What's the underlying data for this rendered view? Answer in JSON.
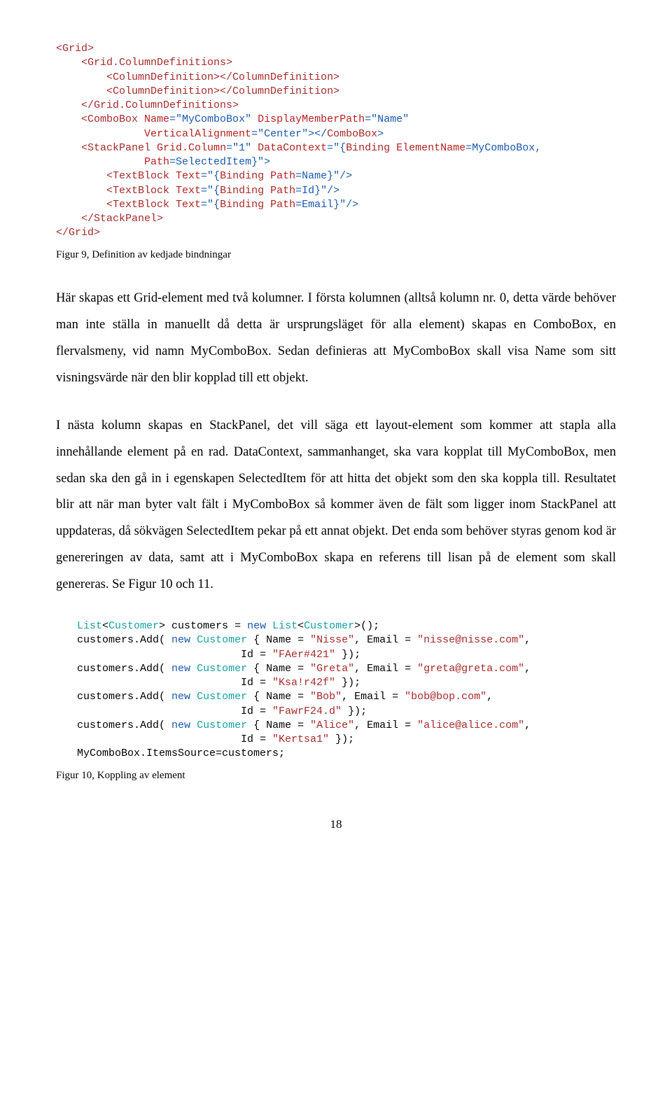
{
  "code1": {
    "l1": {
      "a": "<Grid>"
    },
    "l2": {
      "a": "    ",
      "b": "<Grid.ColumnDefinitions>"
    },
    "l3": {
      "a": "        ",
      "b": "<ColumnDefinition></ColumnDefinition>"
    },
    "l4": {
      "a": "        ",
      "b": "<ColumnDefinition></ColumnDefinition>"
    },
    "l5": {
      "a": "    ",
      "b": "</Grid.ColumnDefinitions>"
    },
    "l6": {
      "a": "    ",
      "b": "<ComboBox",
      "c": " Name",
      "d": "=\"MyComboBox\"",
      "e": " DisplayMemberPath",
      "f": "=\"Name\""
    },
    "l7": {
      "a": "              ",
      "b": "VerticalAlignment",
      "c": "=\"Center\"></",
      "d": "ComboBox",
      "e": ">"
    },
    "l8": {
      "a": "    ",
      "b": "<StackPanel",
      "c": " Grid.Column",
      "d": "=\"1\"",
      "e": " DataContext",
      "f": "=\"{",
      "g": "Binding",
      "h": " ElementName",
      "i": "=MyComboBox,",
      "j": ""
    },
    "l9": {
      "a": "              ",
      "b": "Path",
      "c": "=SelectedItem}\">"
    },
    "l10": {
      "a": "        ",
      "b": "<TextBlock",
      "c": " Text",
      "d": "=\"{",
      "e": "Binding",
      "f": " Path",
      "g": "=Name}\"/>"
    },
    "l11": {
      "a": "        ",
      "b": "<TextBlock",
      "c": " Text",
      "d": "=\"{",
      "e": "Binding",
      "f": " Path",
      "g": "=Id}\"/>"
    },
    "l12": {
      "a": "        ",
      "b": "<TextBlock",
      "c": " Text",
      "d": "=\"{",
      "e": "Binding",
      "f": " Path",
      "g": "=Email}\"/>"
    },
    "l13": {
      "a": "    ",
      "b": "</StackPanel>"
    },
    "l14": {
      "a": "</Grid>"
    }
  },
  "caption1": "Figur 9, Definition av kedjade bindningar",
  "para1": "Här skapas ett Grid-element med två kolumner. I första kolumnen (alltså kolumn nr. 0, detta värde behöver man inte ställa in manuellt då detta är ursprungsläget för alla element) skapas en ComboBox, en flervalsmeny, vid namn MyComboBox. Sedan definieras att MyComboBox skall visa Name som sitt visningsvärde när den blir kopplad till ett objekt.",
  "para2": "I nästa kolumn skapas en StackPanel, det vill säga ett layout-element som kommer att stapla alla innehållande element på en rad. DataContext, sammanhanget, ska vara kopplat till MyComboBox, men sedan ska den gå in i egenskapen SelectedItem för att hitta det objekt som den ska koppla till. Resultatet blir att när man byter valt fält i MyComboBox så kommer även de fält som ligger inom StackPanel att uppdateras, då sökvägen SelectedItem pekar på ett annat objekt. Det enda som behöver styras genom kod är genereringen av data, samt att i MyComboBox skapa en referens till lisan på de element som skall genereras. Se Figur 10 och 11.",
  "code2": {
    "l1": {
      "a": "List",
      "b": "<",
      "c": "Customer",
      "d": "> customers = ",
      "e": "new",
      "f": " ",
      "g": "List",
      "h": "<",
      "i": "Customer",
      "j": ">();"
    },
    "l2": {
      "a": "customers.Add( ",
      "b": "new",
      "c": " ",
      "d": "Customer",
      "e": " { Name = ",
      "f": "\"Nisse\"",
      "g": ", Email = ",
      "h": "\"nisse@nisse.com\"",
      "i": ","
    },
    "l3": {
      "a": "                          Id = ",
      "b": "\"FAer#421\"",
      "c": " });"
    },
    "l4": {
      "a": "customers.Add( ",
      "b": "new",
      "c": " ",
      "d": "Customer",
      "e": " { Name = ",
      "f": "\"Greta\"",
      "g": ", Email = ",
      "h": "\"greta@greta.com\"",
      "i": ","
    },
    "l5": {
      "a": "                          Id = ",
      "b": "\"Ksa!r42f\"",
      "c": " });"
    },
    "l6": {
      "a": "customers.Add( ",
      "b": "new",
      "c": " ",
      "d": "Customer",
      "e": " { Name = ",
      "f": "\"Bob\"",
      "g": ", Email = ",
      "h": "\"bob@bop.com\"",
      "i": ","
    },
    "l7": {
      "a": "                          Id = ",
      "b": "\"FawrF24.d\"",
      "c": " });"
    },
    "l8": {
      "a": "customers.Add( ",
      "b": "new",
      "c": " ",
      "d": "Customer",
      "e": " { Name = ",
      "f": "\"Alice\"",
      "g": ", Email = ",
      "h": "\"alice@alice.com\"",
      "i": ","
    },
    "l9": {
      "a": "                          Id = ",
      "b": "\"Kertsa1\"",
      "c": " });"
    },
    "l10": {
      "a": "MyComboBox.ItemsSource=customers;"
    }
  },
  "caption2": "Figur 10, Koppling av element",
  "pageNumber": "18"
}
